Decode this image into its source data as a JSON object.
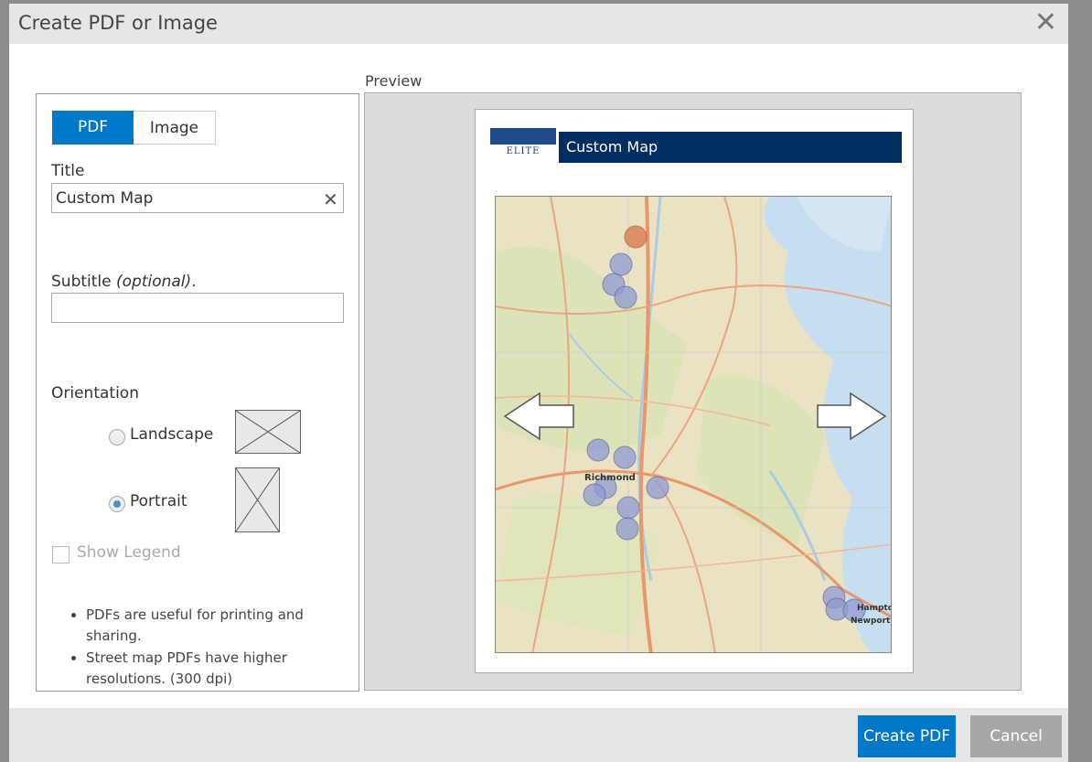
{
  "dialog": {
    "title": "Create PDF or Image",
    "close_glyph": "✕"
  },
  "tabs": {
    "pdf": "PDF",
    "image": "Image",
    "active": "PDF"
  },
  "fields": {
    "title_label": "Title",
    "title_value": "Custom Map",
    "subtitle_label": "Subtitle",
    "subtitle_optional": "(optional)",
    "subtitle_suffix": ".",
    "subtitle_value": ""
  },
  "orientation": {
    "label": "Orientation",
    "landscape": "Landscape",
    "portrait": "Portrait",
    "selected": "Portrait"
  },
  "legend": {
    "label": "Show Legend",
    "checked": false
  },
  "notes": [
    "PDFs are useful for printing and sharing.",
    "Street map PDFs have higher resolutions. (300 dpi)"
  ],
  "preview": {
    "label": "Preview",
    "page_title": "Custom Map",
    "logo_text": "ELITE",
    "map_labels": [
      "Richmond",
      "Hampton",
      "Newport N"
    ]
  },
  "buttons": {
    "create": "Create PDF",
    "cancel": "Cancel"
  },
  "colors": {
    "primary": "#0078c8",
    "cancel": "#a7a7a7",
    "page_title_bar": "#002d62",
    "map_land": "#efe7c6",
    "map_water": "#c6dff0",
    "map_roads": "#e8966a"
  }
}
